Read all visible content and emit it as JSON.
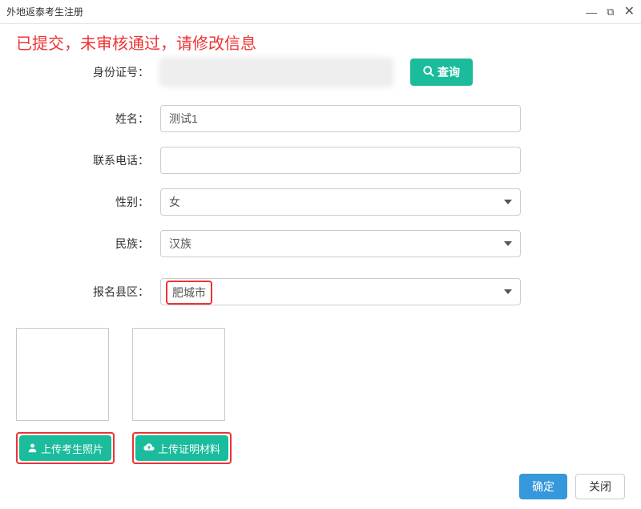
{
  "window": {
    "title": "外地返泰考生注册"
  },
  "status": {
    "message": "已提交，未审核通过，请修改信息"
  },
  "form": {
    "id_label": "身份证号：",
    "id_value": "",
    "query_label": "查询",
    "name_label": "姓名：",
    "name_value": "测试1",
    "phone_label": "联系电话：",
    "phone_value": "",
    "gender_label": "性别：",
    "gender_value": "女",
    "ethnicity_label": "民族：",
    "ethnicity_value": "汉族",
    "district_label": "报名县区：",
    "district_value": "肥城市"
  },
  "upload": {
    "photo_btn": "上传考生照片",
    "material_btn": "上传证明材料"
  },
  "footer": {
    "ok": "确定",
    "close": "关闭"
  }
}
